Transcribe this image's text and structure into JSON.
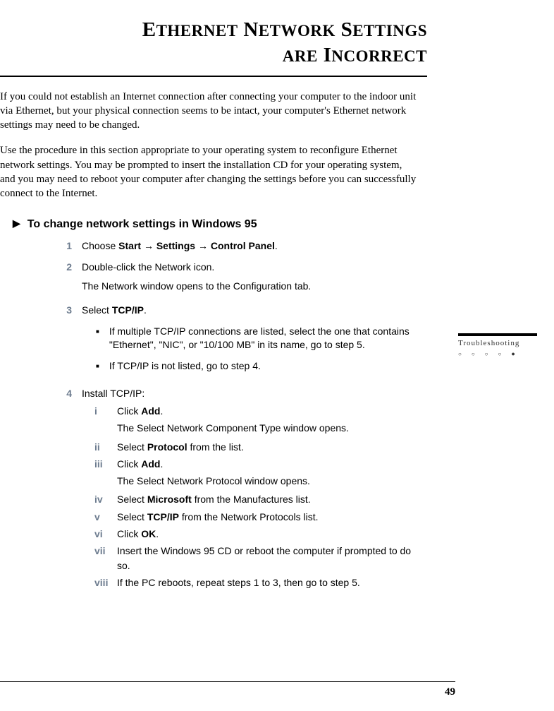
{
  "title_line1_lead": "E",
  "title_line1_rest_a": "THERNET",
  "title_line1_lead_b": "N",
  "title_line1_rest_b": "ETWORK",
  "title_line1_lead_c": "S",
  "title_line1_rest_c": "ETTINGS",
  "title_line2_lead_a": "ARE",
  "title_line2_lead_b": "I",
  "title_line2_rest_b": "NCORRECT",
  "intro_p1": "If you could not establish an Internet connection after connecting your computer to the indoor unit via Ethernet, but your physical connection seems to be intact, your computer's Ethernet network settings may need to be changed.",
  "intro_p2": "Use the procedure in this section appropriate to your operating system to reconfigure Ethernet network settings. You may be prompted to insert the installation CD for your operating system, and you may need to reboot your computer after changing the settings before you can successfully connect to the Internet.",
  "section_heading": "To change network settings in Windows 95",
  "steps": {
    "s1": {
      "num": "1",
      "pre": "Choose ",
      "b1": "Start",
      "arrow": " → ",
      "b2": "Settings",
      "b3": "Control Panel",
      "post": "."
    },
    "s2": {
      "num": "2",
      "text": "Double-click the Network icon.",
      "note": "The Network window opens to the Configuration tab."
    },
    "s3": {
      "num": "3",
      "pre": "Select ",
      "b": "TCP/IP",
      "post": ".",
      "bullet1": "If multiple TCP/IP connections are listed, select the one that contains \"Ethernet\", \"NIC\", or \"10/100 MB\" in its name, go to step 5.",
      "bullet2": "If TCP/IP is not listed, go to step 4."
    },
    "s4": {
      "num": "4",
      "text": "Install TCP/IP:",
      "sub": {
        "i": {
          "n": "i",
          "pre": "Click ",
          "b": "Add",
          "post": ".",
          "note": "The Select Network Component Type window opens."
        },
        "ii": {
          "n": "ii",
          "pre": "Select ",
          "b": "Protocol",
          "post": " from the list."
        },
        "iii": {
          "n": "iii",
          "pre": "Click ",
          "b": "Add",
          "post": ".",
          "note": "The Select Network Protocol window opens."
        },
        "iv": {
          "n": "iv",
          "pre": "Select ",
          "b": "Microsoft",
          "post": " from the Manufactures list."
        },
        "v": {
          "n": "v",
          "pre": "Select ",
          "b": "TCP/IP",
          "post": " from the Network Protocols list."
        },
        "vi": {
          "n": "vi",
          "pre": "Click ",
          "b": "OK",
          "post": "."
        },
        "vii": {
          "n": "vii",
          "text": "Insert the Windows 95 CD or reboot the computer if prompted to do so."
        },
        "viii": {
          "n": "viii",
          "text": "If the PC reboots, repeat steps 1 to 3, then go to step 5."
        }
      }
    }
  },
  "sidebar_label": "Troubleshooting",
  "page_number": "49"
}
